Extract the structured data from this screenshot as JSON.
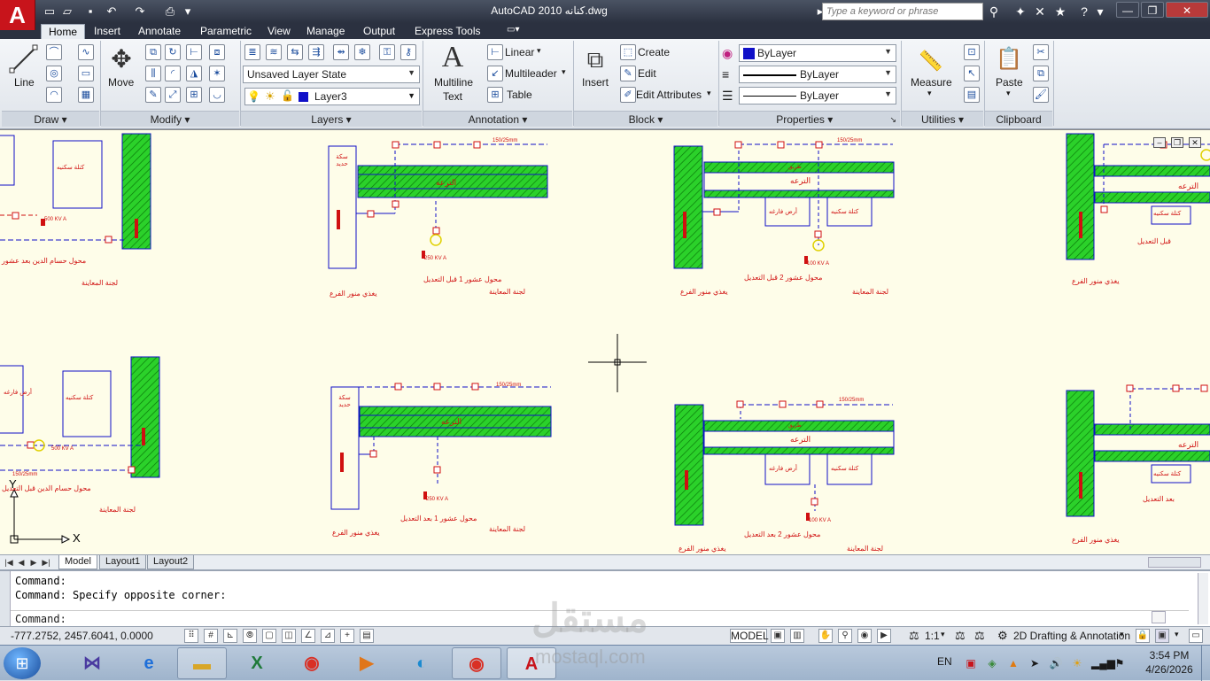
{
  "window": {
    "title": "AutoCAD 2010   كنانه.dwg",
    "search_placeholder": "Type a keyword or phrase"
  },
  "tabs": [
    "Home",
    "Insert",
    "Annotate",
    "Parametric",
    "View",
    "Manage",
    "Output",
    "Express Tools"
  ],
  "ribbon": {
    "draw": {
      "title": "Draw",
      "line": "Line"
    },
    "modify": {
      "title": "Modify",
      "move": "Move"
    },
    "layers": {
      "title": "Layers",
      "layer_state": "Unsaved Layer State",
      "current_layer": "Layer3"
    },
    "annotation": {
      "title": "Annotation",
      "mtext_line1": "Multiline",
      "mtext_line2": "Text",
      "linear": "Linear",
      "multileader": "Multileader",
      "table": "Table"
    },
    "block": {
      "title": "Block",
      "insert": "Insert",
      "create": "Create",
      "edit": "Edit",
      "edit_attributes": "Edit Attributes"
    },
    "properties": {
      "title": "Properties",
      "color": "ByLayer",
      "linetype": "ByLayer",
      "lineweight": "ByLayer"
    },
    "utilities": {
      "title": "Utilities",
      "measure": "Measure"
    },
    "clipboard": {
      "title": "Clipboard",
      "paste": "Paste"
    }
  },
  "drawing": {
    "dim_label": "150/25mm",
    "kva_250": "250 KV A",
    "kva_500": "500 KV A",
    "kva_100": "100 KV A",
    "transformer_1_before": "محول عشور 1 قبل التعديل",
    "transformer_1_after": "محول عشور 1 بعد التعديل",
    "transformer_2_before": "محول عشور 2 قبل التعديل",
    "transformer_2_after": "محول عشور 2 بعد التعديل",
    "hossam_after": "محول حسام الدين بعد عشور",
    "hossam_before": "محول حسام الدين قبل التعديل",
    "feed": "يغذي منور الفرع",
    "committee": "لجنة المعاينة",
    "canal": "الترعه",
    "housing": "كتلة سكنيه",
    "vacant": "أرض فارغه",
    "road": "طريق",
    "rail": "سكة حديد",
    "after_mod": "بعد التعديل",
    "before_mod": "قبل التعديل",
    "ucs_x": "X",
    "ucs_y": "Y"
  },
  "layout_tabs": [
    "Model",
    "Layout1",
    "Layout2"
  ],
  "command": {
    "history_1": "Command:",
    "history_2": "Command: Specify opposite corner:",
    "prompt": "Command:"
  },
  "status": {
    "coordinates": "-777.2752, 2457.6041, 0.0000",
    "model": "MODEL",
    "scale": "1:1",
    "workspace": "2D Drafting & Annotation"
  },
  "taskbar": {
    "language": "EN",
    "time": "3:54 PM",
    "date": "4/26/2026"
  },
  "watermark": {
    "brand": "مستقل",
    "url": "mostaql.com"
  },
  "colors": {
    "title_bg": "#2b3140",
    "canvas_bg": "#fefde9",
    "hatch_green": "#22c21a",
    "draw_blue": "#1010c8",
    "draw_red": "#d01010",
    "autocad_red": "#c8141b"
  }
}
